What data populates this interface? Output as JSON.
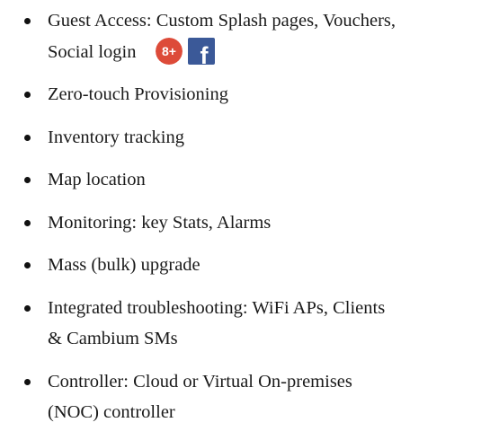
{
  "list": {
    "items": [
      {
        "lines": [
          "Guest Access: Custom Splash pages, Vouchers,",
          "Social login"
        ],
        "has_social_icons": true
      },
      {
        "lines": [
          "Zero-touch Provisioning"
        ]
      },
      {
        "lines": [
          "Inventory tracking"
        ]
      },
      {
        "lines": [
          "Map location"
        ]
      },
      {
        "lines": [
          "Monitoring: key Stats, Alarms"
        ]
      },
      {
        "lines": [
          "Mass (bulk) upgrade"
        ]
      },
      {
        "lines": [
          "Integrated troubleshooting: WiFi APs, Clients",
          "& Cambium SMs"
        ]
      },
      {
        "lines": [
          "Controller: Cloud or Virtual On-premises",
          "(NOC) controller"
        ]
      }
    ]
  },
  "icons": {
    "gplus": {
      "name": "google-plus-icon",
      "label": "8+",
      "color": "#dd4b39"
    },
    "facebook": {
      "name": "facebook-icon",
      "label": "f",
      "color": "#3b5998"
    }
  },
  "colors": {
    "text": "#1a1a1a",
    "background": "#ffffff"
  }
}
